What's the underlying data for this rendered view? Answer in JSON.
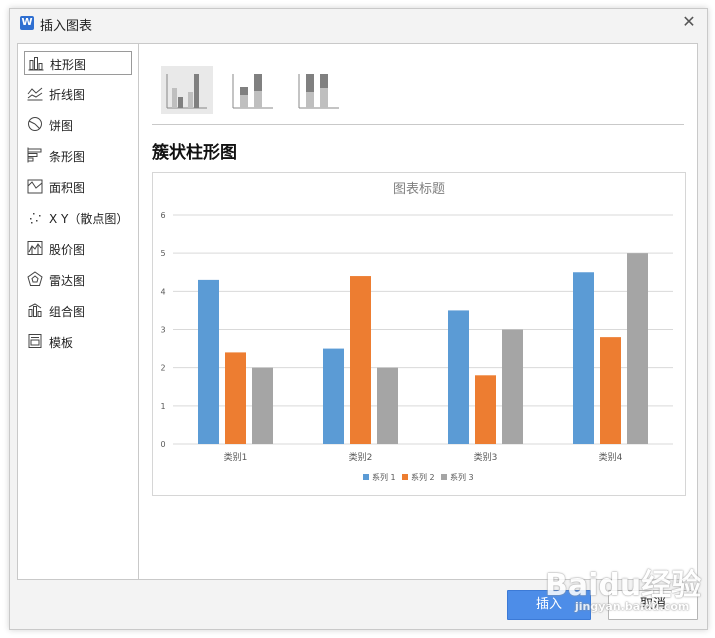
{
  "dialog": {
    "app_icon": "W",
    "title": "插入图表",
    "close_glyph": "✕"
  },
  "sidebar": {
    "items": [
      {
        "label": "柱形图",
        "icon": "column-chart-icon",
        "active": true
      },
      {
        "label": "折线图",
        "icon": "line-chart-icon"
      },
      {
        "label": "饼图",
        "icon": "pie-chart-icon"
      },
      {
        "label": "条形图",
        "icon": "bar-chart-icon"
      },
      {
        "label": "面积图",
        "icon": "area-chart-icon"
      },
      {
        "label": "X Y（散点图）",
        "icon": "scatter-chart-icon"
      },
      {
        "label": "股价图",
        "icon": "stock-chart-icon"
      },
      {
        "label": "雷达图",
        "icon": "radar-chart-icon"
      },
      {
        "label": "组合图",
        "icon": "combo-chart-icon"
      },
      {
        "label": "模板",
        "icon": "template-icon"
      }
    ]
  },
  "subtypes": [
    {
      "icon": "clustered-column-icon",
      "selected": true
    },
    {
      "icon": "stacked-column-icon"
    },
    {
      "icon": "percent-stacked-column-icon"
    }
  ],
  "chart_type_title": "簇状柱形图",
  "chart_data": {
    "type": "bar",
    "title": "图表标题",
    "categories": [
      "类别1",
      "类别2",
      "类别3",
      "类别4"
    ],
    "series": [
      {
        "name": "系列 1",
        "color": "#5b9bd5",
        "values": [
          4.3,
          2.5,
          3.5,
          4.5
        ]
      },
      {
        "name": "系列 2",
        "color": "#ed7d31",
        "values": [
          2.4,
          4.4,
          1.8,
          2.8
        ]
      },
      {
        "name": "系列 3",
        "color": "#a5a5a5",
        "values": [
          2,
          2,
          3,
          5
        ]
      }
    ],
    "ylim": [
      0,
      6
    ],
    "yticks": [
      "0",
      "1",
      "2",
      "3",
      "4",
      "5",
      "6"
    ],
    "grid": true,
    "legend_position": "bottom"
  },
  "footer": {
    "insert_label": "插入",
    "cancel_label": "取消"
  },
  "watermark": {
    "logo_text": "Baidu经验",
    "url": "jingyan.baidu.com"
  }
}
